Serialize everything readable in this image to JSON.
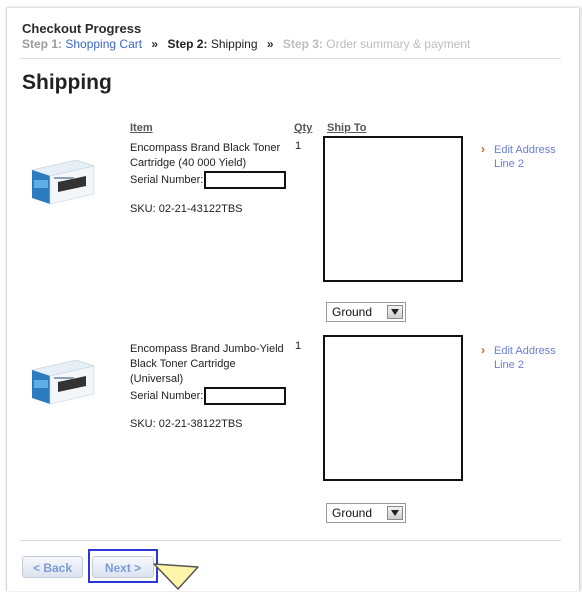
{
  "progress": {
    "title": "Checkout Progress",
    "steps": [
      {
        "prefix": "Step 1:",
        "label": "Shopping Cart"
      },
      {
        "prefix": "Step 2:",
        "label": "Shipping"
      },
      {
        "prefix": "Step 3:",
        "label": "Order summary & payment"
      }
    ],
    "separator": "»"
  },
  "page": {
    "title": "Shipping"
  },
  "columns": {
    "item": "Item",
    "qty": "Qty",
    "ship_to": "Ship To"
  },
  "items": [
    {
      "name": "Encompass Brand Black Toner Cartridge (40 000 Yield)",
      "serial_label": "Serial Number:",
      "serial_value": "",
      "sku": "SKU: 02-21-43122TBS",
      "qty": "1",
      "edit_address": "Edit Address Line 2",
      "shipping_method": "Ground",
      "product_image_brand": "ENCOMPASS"
    },
    {
      "name": "Encompass Brand Jumbo-Yield Black Toner Cartridge (Universal)",
      "serial_label": "Serial Number:",
      "serial_value": "",
      "sku": "SKU: 02-21-38122TBS",
      "qty": "1",
      "edit_address": "Edit Address Line 2",
      "shipping_method": "Ground",
      "product_image_brand": "ENCOMPASS"
    }
  ],
  "buttons": {
    "back": "< Back",
    "next": "Next >"
  },
  "colors": {
    "link": "#3b68c6",
    "chevron": "#e0611a",
    "highlight": "#2d37d8"
  }
}
